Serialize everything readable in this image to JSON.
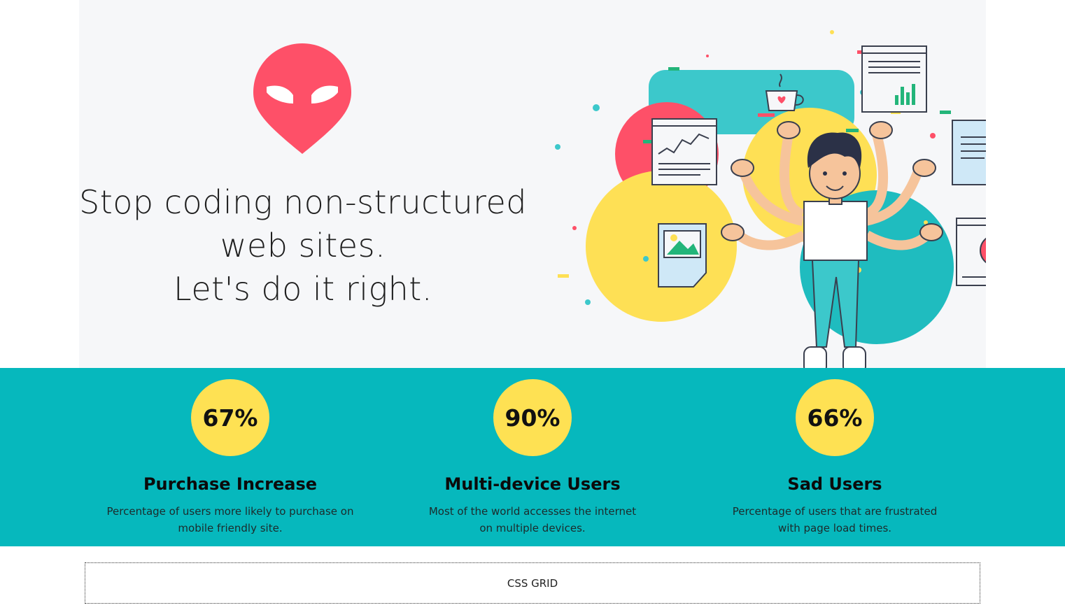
{
  "hero": {
    "headline_line1": "Stop coding non-structured",
    "headline_line2": "web sites.",
    "headline_line3": "Let's do it right.",
    "logo_icon": "alien-face-pin-logo",
    "illustration_icon": "multitasking-developer-illustration"
  },
  "stats": [
    {
      "value": "67%",
      "title": "Purchase Increase",
      "description": "Percentage of users more likely to purchase on mobile friendly site."
    },
    {
      "value": "90%",
      "title": "Multi-device Users",
      "description": "Most of the world accesses the internet on multiple devices."
    },
    {
      "value": "66%",
      "title": "Sad Users",
      "description": "Percentage of users that are frustrated with page load times."
    }
  ],
  "footer": {
    "grid_label": "CSS GRID"
  },
  "colors": {
    "hero_bg": "#f6f7f9",
    "stats_bg": "#06b8bd",
    "stat_circle": "#fee153",
    "logo_red": "#fe5068",
    "teal": "#3cc8cb",
    "yellow": "#fee055"
  }
}
